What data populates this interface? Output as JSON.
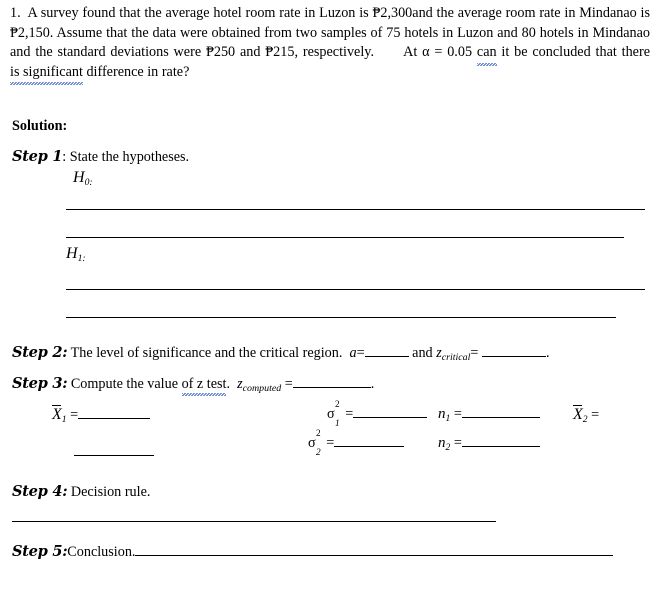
{
  "document": {
    "type": "worksheet",
    "problem": {
      "number": "1.",
      "text_segments": [
        {
          "text": "A survey found that the average hotel room rate in Luzon is ₱2,300and the average room rate in Mindanao is ₱2,150. Assume that the data were obtained from two samples of 75 hotels in Luzon and 80 hotels in Mindanao and the standard deviations were ₱250 and ₱215, respectively.",
          "marked": false
        },
        {
          "text": "     At α = 0.05 ",
          "marked": false
        },
        {
          "text": "can",
          "marked": true
        },
        {
          "text": " it be concluded that there ",
          "marked": false
        },
        {
          "text": "is significant",
          "marked": true
        },
        {
          "text": " difference in rate?",
          "marked": false
        }
      ],
      "full_text": "1. A survey found that the average hotel room rate in Luzon is ₱2,300and the average room rate in Mindanao is ₱2,150. Assume that the data were obtained from two samples of 75 hotels in Luzon and 80 hotels in Mindanao and the standard deviations were ₱250 and ₱215, respectively. At α = 0.05 can it be concluded that there is significant difference in rate?",
      "values": {
        "mean_luzon": "₱2,300",
        "mean_mindanao": "₱2,150",
        "n_luzon": "75",
        "n_mindanao": "80",
        "sd_luzon": "₱250",
        "sd_mindanao": "₱215",
        "alpha": "0.05"
      }
    },
    "solution_heading": "Solution:",
    "steps": {
      "step1": {
        "label": "Step 1",
        "separator": ":",
        "text": "State the hypotheses.",
        "h_null": "H",
        "h_null_sub": "0:",
        "h_alt": "H",
        "h_alt_sub": "1:"
      },
      "step2": {
        "label": "Step 2:",
        "text": "The level of significance and the critical region.",
        "alpha_symbol": "a",
        "equals": "=",
        "conjunction": "and",
        "z_symbol": "z",
        "z_subscript": "critical",
        "z_equals": "=",
        "trailing_period": "."
      },
      "step3": {
        "label": "Step 3:",
        "text_before": "Compute the value ",
        "text_marked": "of z test",
        "text_after": ".",
        "z_symbol": "z",
        "z_subscript": "computed",
        "z_equals": "=",
        "trailing_period": "."
      },
      "step4": {
        "label": "Step 4:",
        "text": "Decision rule."
      },
      "step5": {
        "label": "Step 5:",
        "text": "Conclusion."
      }
    },
    "formula_fields": [
      {
        "name": "xbar1",
        "symbol": "X",
        "subscript": "1",
        "overbar": true,
        "equals": "="
      },
      {
        "name": "sigma_sq_1",
        "symbol": "σ",
        "superscript": "2",
        "subscript": "1",
        "equals": "="
      },
      {
        "name": "n1",
        "symbol": "n",
        "subscript": "1",
        "equals": "="
      },
      {
        "name": "xbar2",
        "symbol": "X",
        "subscript": "2",
        "overbar": true,
        "equals": "="
      },
      {
        "name": "sigma_sq_2",
        "symbol": "σ",
        "superscript": "2",
        "subscript": "2",
        "equals": "="
      },
      {
        "name": "n2",
        "symbol": "n",
        "subscript": "2",
        "equals": "="
      }
    ],
    "colors": {
      "text": "#000000",
      "background": "#ffffff",
      "grammar_underline": "#3a66c8",
      "rule_line": "#000000"
    }
  }
}
